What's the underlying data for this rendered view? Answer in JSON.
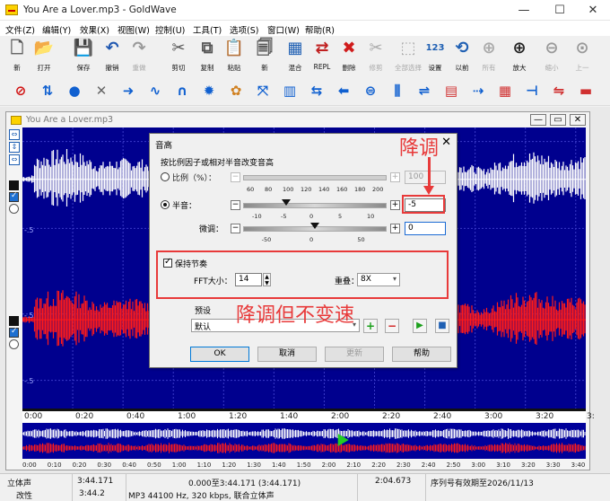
{
  "window": {
    "title": "You Are a Lover.mp3 - GoldWave",
    "minimize": "—",
    "maximize": "☐",
    "close": "✕"
  },
  "menu": [
    "文件(Z)",
    "编辑(Y)",
    "效果(X)",
    "视图(W)",
    "控制(U)",
    "工具(T)",
    "选项(S)",
    "窗口(W)",
    "帮助(R)"
  ],
  "toolbar": [
    {
      "label": "新",
      "icon": "new-file-icon",
      "glyph": "🗋",
      "color": "#555"
    },
    {
      "label": "打开",
      "icon": "open-folder-icon",
      "glyph": "📂",
      "color": "#d49a1a"
    },
    {
      "label": "保存",
      "icon": "save-disk-icon",
      "glyph": "💾",
      "color": "#2a4c9a"
    },
    {
      "label": "撤销",
      "icon": "undo-icon",
      "glyph": "↶",
      "color": "#1f57b0"
    },
    {
      "label": "重做",
      "icon": "redo-icon",
      "glyph": "↷",
      "color": "#999",
      "disabled": true
    },
    {
      "label": "剪切",
      "icon": "scissors-icon",
      "glyph": "✂",
      "color": "#555"
    },
    {
      "label": "复制",
      "icon": "copy-icon",
      "glyph": "⧉",
      "color": "#555"
    },
    {
      "label": "粘贴",
      "icon": "paste-icon",
      "glyph": "📋",
      "color": "#8a6b2a"
    },
    {
      "label": "新",
      "icon": "paste-new-icon",
      "glyph": "🗐",
      "color": "#555"
    },
    {
      "label": "混合",
      "icon": "mix-icon",
      "glyph": "▦",
      "color": "#1e5fb3"
    },
    {
      "label": "REPL",
      "icon": "replace-icon",
      "glyph": "⇄",
      "color": "#c02020"
    },
    {
      "label": "删除",
      "icon": "delete-x-icon",
      "glyph": "✖",
      "color": "#d01c1c"
    },
    {
      "label": "修剪",
      "icon": "trim-icon",
      "glyph": "✂",
      "color": "#aaa",
      "disabled": true
    },
    {
      "label": "全部选择",
      "icon": "select-all-icon",
      "glyph": "⬚",
      "color": "#aaa",
      "disabled": true
    },
    {
      "label": "设置",
      "icon": "set-marker-icon",
      "glyph": "123",
      "color": "#1e5fb3"
    },
    {
      "label": "以前",
      "icon": "previous-icon",
      "glyph": "⟲",
      "color": "#1e5fb3"
    },
    {
      "label": "所有",
      "icon": "zoom-all-icon",
      "glyph": "⊕",
      "color": "#aaa",
      "disabled": true
    },
    {
      "label": "放大",
      "icon": "zoom-in-icon",
      "glyph": "⊕",
      "color": "#222"
    },
    {
      "label": "缩小",
      "icon": "zoom-out-icon",
      "glyph": "⊖",
      "color": "#999",
      "disabled": true
    },
    {
      "label": "上一",
      "icon": "zoom-previous-icon",
      "glyph": "⊙",
      "color": "#999",
      "disabled": true
    }
  ],
  "effects_toolbar": [
    {
      "icon": "stop-sign-icon",
      "glyph": "⊘",
      "color": "#d01010"
    },
    {
      "icon": "vertical-arrows-icon",
      "glyph": "⇅",
      "color": "#1060d0"
    },
    {
      "icon": "sphere-icon",
      "glyph": "●",
      "color": "#1060d0"
    },
    {
      "icon": "crossfade-icon",
      "glyph": "✕",
      "color": "#666"
    },
    {
      "icon": "arrow-right-icon",
      "glyph": "➜",
      "color": "#1060d0"
    },
    {
      "icon": "wave-icon",
      "glyph": "∿",
      "color": "#1060d0"
    },
    {
      "icon": "magnet-icon",
      "glyph": "∩",
      "color": "#1060d0"
    },
    {
      "icon": "gear-icon",
      "glyph": "✹",
      "color": "#1060d0"
    },
    {
      "icon": "color-wheel-icon",
      "glyph": "✿",
      "color": "#d08020"
    },
    {
      "icon": "expand-arrows-icon",
      "glyph": "⤧",
      "color": "#1060d0"
    },
    {
      "icon": "equalizer-bars-icon",
      "glyph": "▥",
      "color": "#1060d0"
    },
    {
      "icon": "swap-arrows-icon",
      "glyph": "⇆",
      "color": "#1060d0"
    },
    {
      "icon": "arrow-left-icon",
      "glyph": "⬅",
      "color": "#1060d0"
    },
    {
      "icon": "compress-icon",
      "glyph": "⊜",
      "color": "#1060d0"
    },
    {
      "icon": "sliders-icon",
      "glyph": "⫼",
      "color": "#1060d0"
    },
    {
      "icon": "pitch-icon",
      "glyph": "⇌",
      "color": "#1060d0"
    },
    {
      "icon": "spectrum-icon",
      "glyph": "▤",
      "color": "#d03030"
    },
    {
      "icon": "doppler-icon",
      "glyph": "⇢",
      "color": "#1060d0"
    },
    {
      "icon": "graphic-eq-icon",
      "glyph": "▦",
      "color": "#d03030"
    },
    {
      "icon": "split-icon",
      "glyph": "⊣",
      "color": "#1060d0"
    },
    {
      "icon": "reverse-icon",
      "glyph": "⇋",
      "color": "#d03030"
    },
    {
      "icon": "level-meter-icon",
      "glyph": "▬",
      "color": "#d03030"
    }
  ],
  "sound": {
    "title": "You Are a Lover.mp3",
    "db_labels": [
      "-.5",
      "-.5",
      ".5",
      "-.5"
    ],
    "time_ticks": [
      "0:00",
      "0:20",
      "0:40",
      "1:00",
      "1:20",
      "1:40",
      "2:00",
      "2:20",
      "2:40",
      "3:00",
      "3:20",
      "3:"
    ],
    "overview_ticks": [
      "0:00",
      "0:10",
      "0:20",
      "0:30",
      "0:40",
      "0:50",
      "1:00",
      "1:10",
      "1:20",
      "1:30",
      "1:40",
      "1:50",
      "2:00",
      "2:10",
      "2:20",
      "2:30",
      "2:40",
      "2:50",
      "3:00",
      "3:10",
      "3:20",
      "3:30",
      "3:40"
    ],
    "left_color": "#ffffff",
    "right_color": "#ff1a1a",
    "background_color": "#00008e",
    "playhead_fraction": 0.56
  },
  "dialog": {
    "title": "音高",
    "group_label": "按比例因子或相对半音改变音高",
    "ratio_label": "比例（%）：",
    "ratio_ticks": [
      "60",
      "80",
      "100",
      "120",
      "140",
      "160",
      "180",
      "200"
    ],
    "ratio_value": "100",
    "ratio_level": 0.0,
    "semitone_label": "半音：",
    "semitone_ticks": [
      "-10",
      "-5",
      "0",
      "5",
      "10"
    ],
    "semitone_value": "-5",
    "semitone_level": -5,
    "fine_label": "微调：",
    "fine_ticks": [
      "-50",
      "0",
      "50"
    ],
    "fine_value": "0",
    "fine_level": 0,
    "keep_tempo_label": "保持节奏",
    "keep_tempo_checked": true,
    "fft_label": "FFT大小：",
    "fft_value": "14",
    "overlap_label": "重叠：",
    "overlap_value": "8X",
    "preset_group_label": "预设",
    "preset_value": "默认",
    "buttons": {
      "ok": "OK",
      "cancel": "取消",
      "update": "更新",
      "help": "帮助"
    }
  },
  "annotations": {
    "pitch_down": "降调",
    "pitch_down_keep_speed": "降调但不变速",
    "color": "#e83a3a"
  },
  "status": {
    "channels": "立体声",
    "duration": "3:44.171",
    "selection": "0.000至3:44.171 (3:44.171)",
    "position": "2:04.673",
    "registration": "序列号有效期至2026/11/13",
    "modified": "改性",
    "length": "3:44.2",
    "format": "MP3 44100 Hz, 320 kbps, 联合立体声"
  }
}
